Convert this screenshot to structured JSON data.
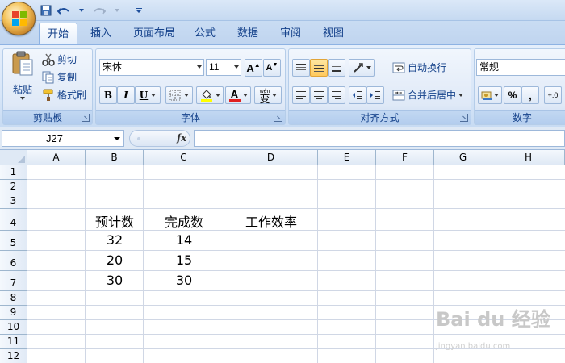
{
  "ribbon_tabs": [
    {
      "label": "开始",
      "active": true
    },
    {
      "label": "插入"
    },
    {
      "label": "页面布局"
    },
    {
      "label": "公式"
    },
    {
      "label": "数据"
    },
    {
      "label": "审阅"
    },
    {
      "label": "视图"
    }
  ],
  "clipboard": {
    "paste_label": "粘贴",
    "cut_label": "剪切",
    "copy_label": "复制",
    "format_painter_label": "格式刷",
    "group_label": "剪贴板"
  },
  "font": {
    "font_name": "宋体",
    "font_size": "11",
    "bold_label": "B",
    "italic_label": "I",
    "underline_label": "U",
    "font_color_letter": "A",
    "phonetic_label": "wén",
    "phonetic_char": "变",
    "grow_label": "A",
    "shrink_label": "A",
    "group_label": "字体"
  },
  "alignment": {
    "wrap_text_label": "自动换行",
    "merge_center_label": "合并后居中",
    "group_label": "对齐方式"
  },
  "number": {
    "format": "常规",
    "percent_label": "%",
    "comma_label": ",",
    "decimal_label": "+.0",
    "group_label": "数字"
  },
  "formula_bar": {
    "name_box": "J27",
    "fx_label": "fx",
    "value": ""
  },
  "columns": [
    "A",
    "B",
    "C",
    "D",
    "E",
    "F",
    "G",
    "H"
  ],
  "rows": [
    "1",
    "2",
    "3",
    "4",
    "5",
    "6",
    "7",
    "8",
    "9",
    "10",
    "11",
    "12"
  ],
  "cells": {
    "B4": "预计数",
    "C4": "完成数",
    "D4": "工作效率",
    "B5": "32",
    "C5": "14",
    "B6": "20",
    "C6": "15",
    "B7": "30",
    "C7": "30"
  },
  "watermark": {
    "brand": "Bai du 经验",
    "url": "jingyan.baidu.com"
  },
  "colors": {
    "ribbon_blue": "#15428b",
    "selected_orange": "#ffc95c",
    "font_red": "#e02020",
    "fill_yellow": "#ffff00"
  }
}
